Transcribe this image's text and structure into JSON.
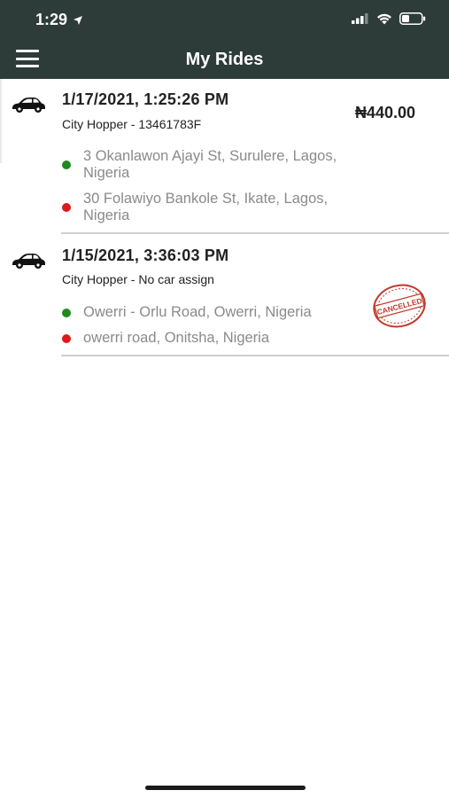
{
  "status_bar": {
    "time": "1:29"
  },
  "header": {
    "title": "My Rides"
  },
  "rides": [
    {
      "datetime": "1/17/2021, 1:25:26 PM",
      "vehicle": "City Hopper - 13461783F",
      "fare": "₦440.00",
      "pickup": "3 Okanlawon Ajayi St, Surulere, Lagos, Nigeria",
      "dropoff": "30 Folawiyo Bankole St, Ikate, Lagos, Nigeria"
    },
    {
      "datetime": "1/15/2021, 3:36:03 PM",
      "vehicle": "City Hopper - No car assign",
      "pickup": "Owerri - Orlu Road, Owerri, Nigeria",
      "dropoff": "owerri road, Onitsha, Nigeria",
      "stamp": "CANCELLED"
    }
  ],
  "colors": {
    "header_bg": "#2d3b39",
    "pickup_dot": "#1f8a1f",
    "dropoff_dot": "#e01818",
    "stamp": "#c0392b"
  }
}
